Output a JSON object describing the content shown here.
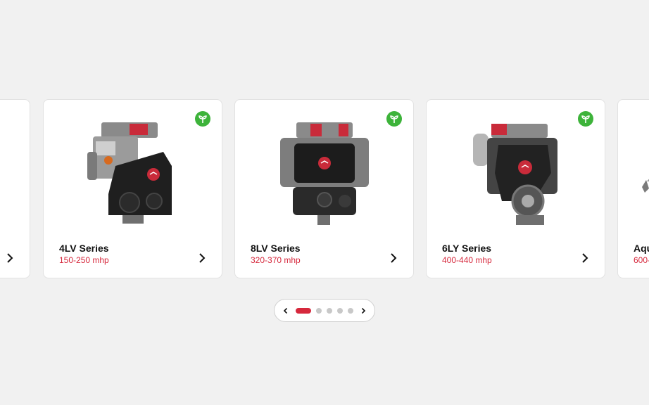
{
  "carousel": {
    "cards": [
      {
        "title": "",
        "power": "",
        "eco": false
      },
      {
        "title": "4LV Series",
        "power": "150-250 mhp",
        "eco": true
      },
      {
        "title": "8LV Series",
        "power": "320-370 mhp",
        "eco": true
      },
      {
        "title": "6LY Series",
        "power": "400-440 mhp",
        "eco": true
      },
      {
        "title": "Aqu",
        "power": "600-",
        "eco": false
      }
    ]
  },
  "pagination": {
    "total_dots": 5,
    "active_dot": 1
  },
  "colors": {
    "accent": "#d6283c",
    "eco_green": "#3db33a",
    "background": "#f1f1f1",
    "card": "#ffffff"
  },
  "icons": {
    "eco": "leaf-sprout-icon",
    "next": "chevron-right-icon",
    "prev": "chevron-left-icon"
  }
}
